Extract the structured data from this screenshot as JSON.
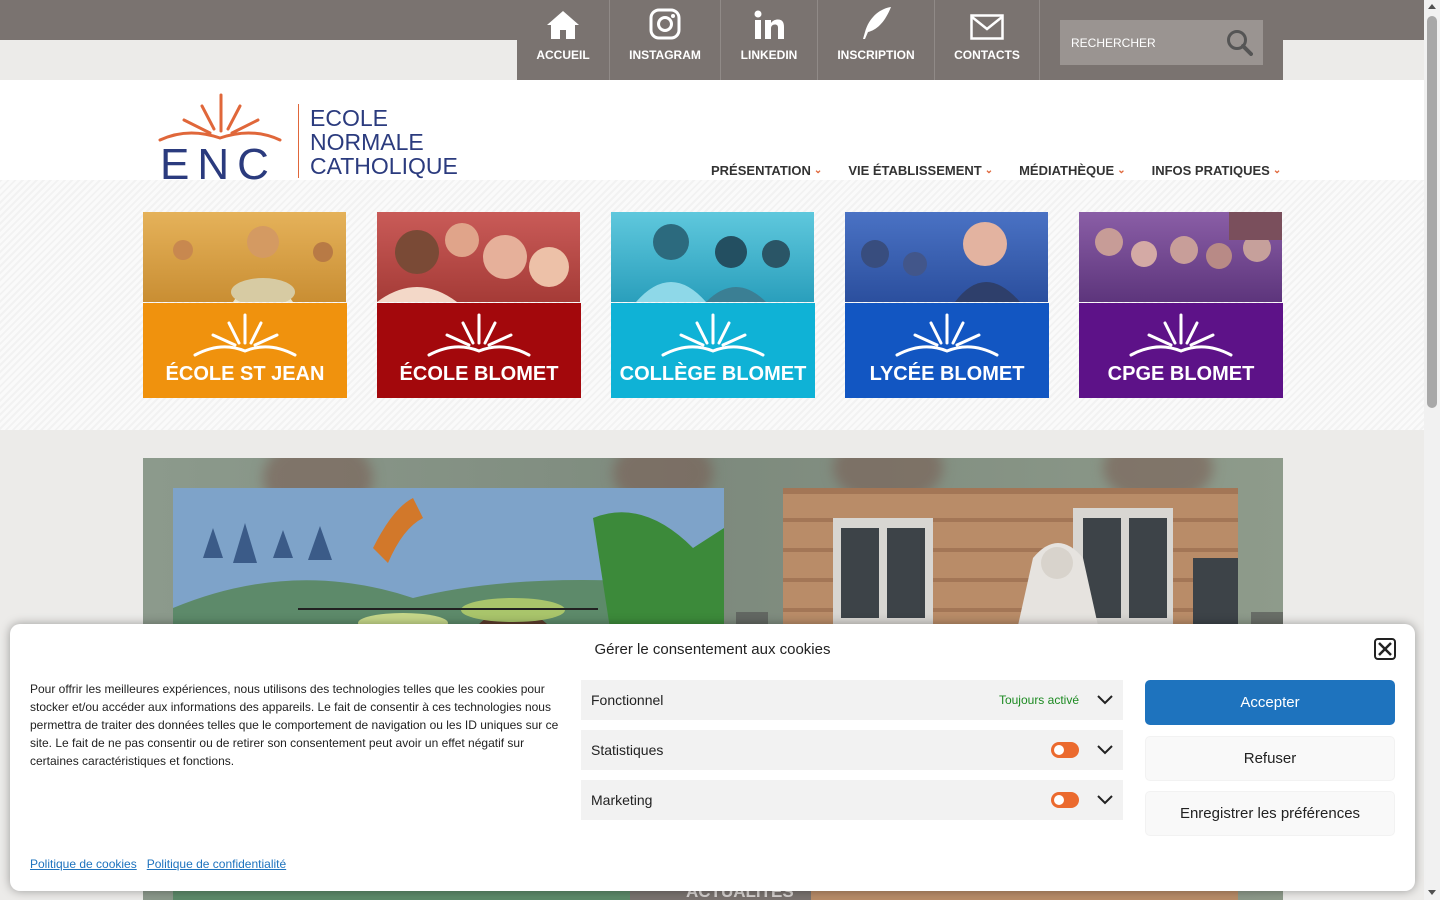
{
  "topnav": {
    "items": [
      {
        "label": "ACCUEIL",
        "icon": "home-icon"
      },
      {
        "label": "INSTAGRAM",
        "icon": "instagram-icon"
      },
      {
        "label": "LINKEDIN",
        "icon": "linkedin-icon"
      },
      {
        "label": "INSCRIPTION",
        "icon": "quill-icon"
      },
      {
        "label": "CONTACTS",
        "icon": "envelope-icon"
      }
    ],
    "search_placeholder": "RECHERCHER"
  },
  "logo": {
    "mark": "ENC",
    "line1": "ECOLE",
    "line2": "NORMALE",
    "line3": "CATHOLIQUE"
  },
  "mainnav": {
    "items": [
      "PRÉSENTATION",
      "VIE ÉTABLISSEMENT",
      "MÉDIATHÈQUE",
      "INFOS PRATIQUES"
    ]
  },
  "tiles": [
    {
      "label": "ÉCOLE ST JEAN",
      "color": "#f0920d"
    },
    {
      "label": "ÉCOLE BLOMET",
      "color": "#a3080c"
    },
    {
      "label": "COLLÈGE BLOMET",
      "color": "#0fb2d6"
    },
    {
      "label": "LYCÉE BLOMET",
      "color": "#1256c2"
    },
    {
      "label": "CPGE BLOMET",
      "color": "#5d1288"
    }
  ],
  "hero": {
    "section_label": "ACTUALITÉS"
  },
  "cookie": {
    "title": "Gérer le consentement aux cookies",
    "description": "Pour offrir les meilleures expériences, nous utilisons des technologies telles que les cookies pour stocker et/ou accéder aux informations des appareils. Le fait de consentir à ces technologies nous permettra de traiter des données telles que le comportement de navigation ou les ID uniques sur ce site. Le fait de ne pas consentir ou de retirer son consentement peut avoir un effet négatif sur certaines caractéristiques et fonctions.",
    "prefs": [
      {
        "label": "Fonctionnel",
        "status": "Toujours activé"
      },
      {
        "label": "Statistiques",
        "status": ""
      },
      {
        "label": "Marketing",
        "status": ""
      }
    ],
    "accept": "Accepter",
    "refuse": "Refuser",
    "save": "Enregistrer les préférences",
    "link_cookies": "Politique de cookies",
    "link_privacy": "Politique de confidentialité"
  },
  "colors": {
    "topbar": "#7a7370",
    "accent": "#e0673a",
    "brand": "#2b3b7e",
    "primary_button": "#1e73be",
    "toggle": "#eb6a2e"
  }
}
